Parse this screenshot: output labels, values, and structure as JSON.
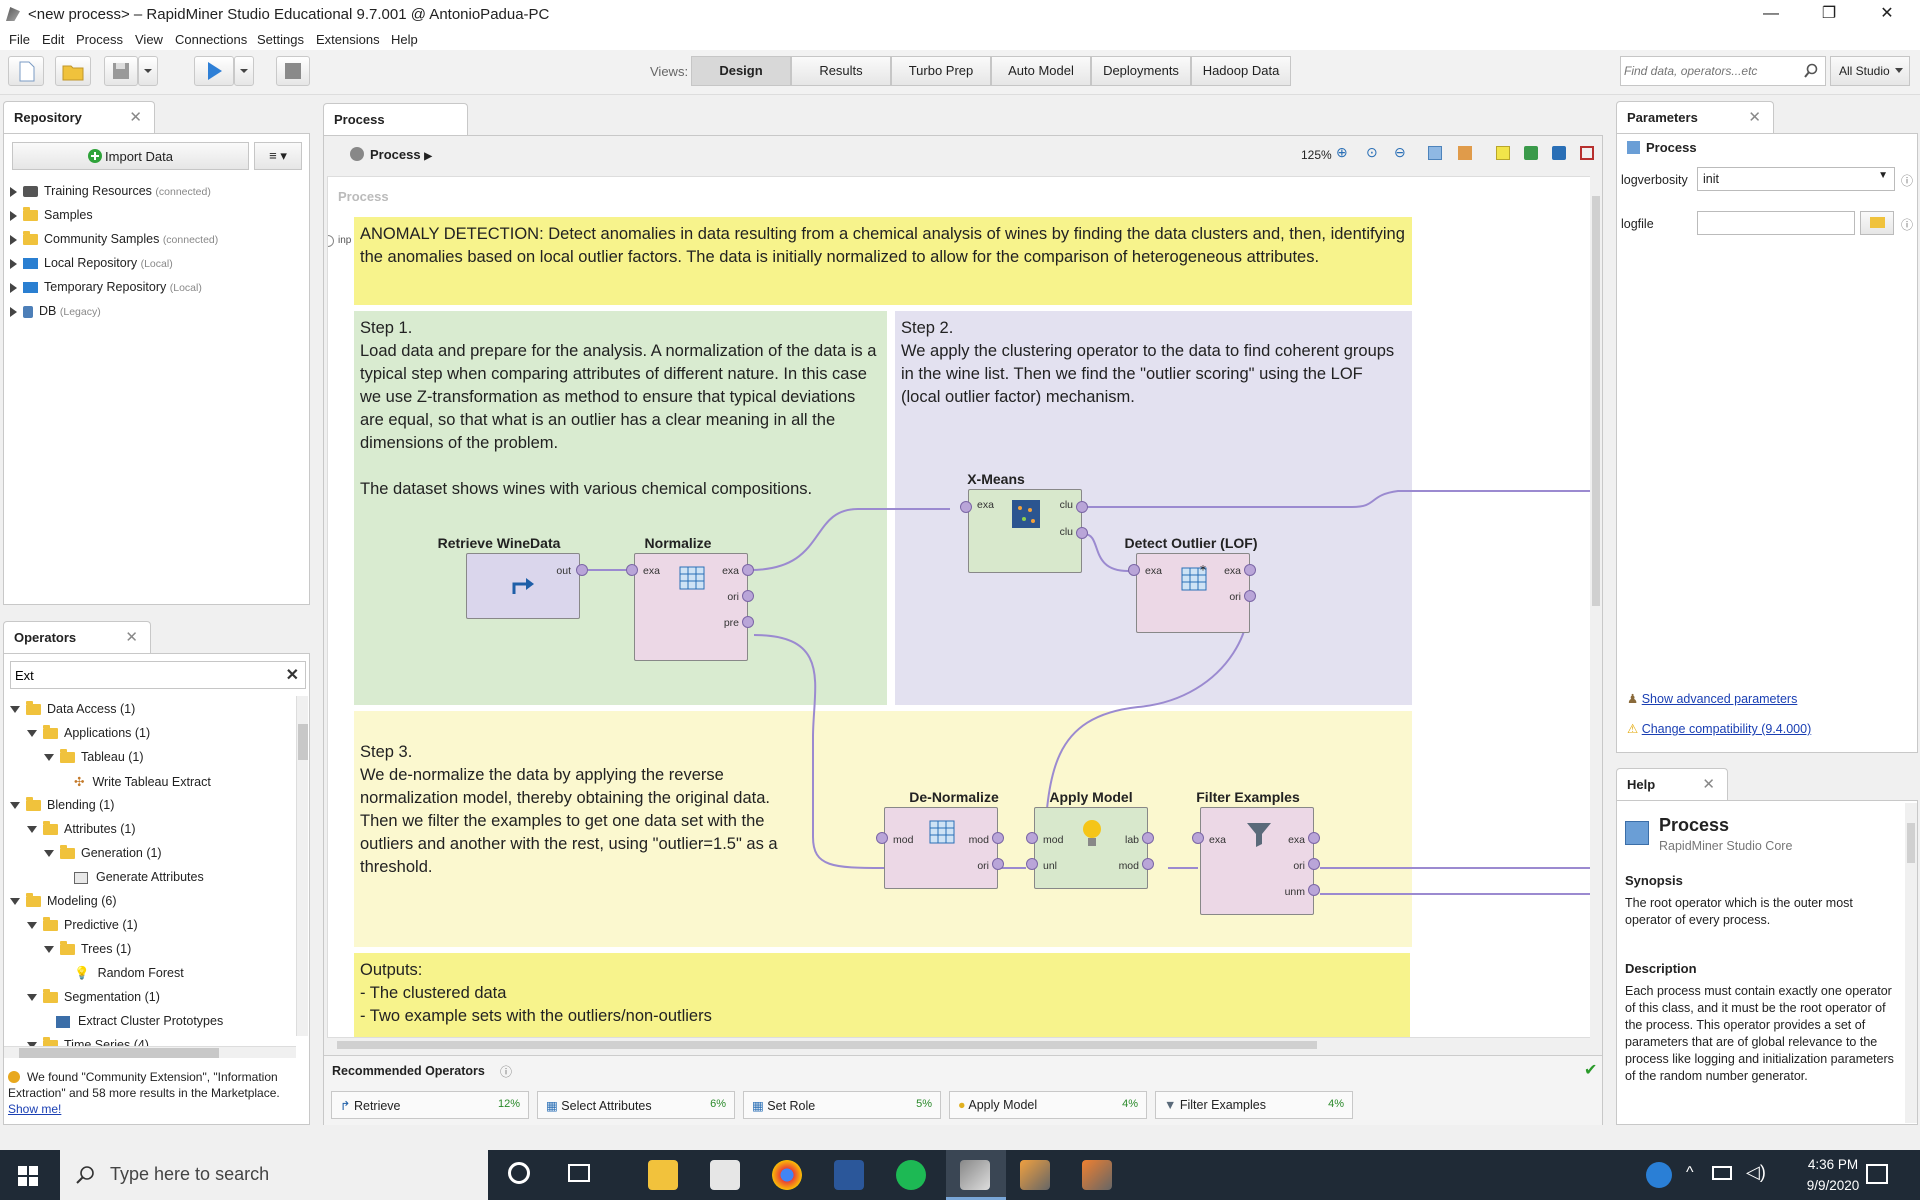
{
  "window": {
    "title": "<new process> – RapidMiner Studio Educational 9.7.001 @ AntonioPadua-PC",
    "minimize": "—",
    "restore": "❐",
    "close": "✕"
  },
  "menu": [
    "File",
    "Edit",
    "Process",
    "View",
    "Connections",
    "Settings",
    "Extensions",
    "Help"
  ],
  "views": {
    "label": "Views:",
    "items": [
      "Design",
      "Results",
      "Turbo Prep",
      "Auto Model",
      "Deployments",
      "Hadoop Data"
    ],
    "active": "Design"
  },
  "search": {
    "placeholder": "Find data, operators...etc",
    "scope": "All Studio"
  },
  "repository": {
    "tab": "Repository",
    "import_button": "Import Data",
    "items": [
      {
        "label": "Training Resources",
        "suffix": "(connected)"
      },
      {
        "label": "Samples",
        "suffix": ""
      },
      {
        "label": "Community Samples",
        "suffix": "(connected)"
      },
      {
        "label": "Local Repository",
        "suffix": "(Local)"
      },
      {
        "label": "Temporary Repository",
        "suffix": "(Local)"
      },
      {
        "label": "DB",
        "suffix": "(Legacy)"
      }
    ]
  },
  "operators": {
    "tab": "Operators",
    "filter_value": "Ext",
    "tree": [
      {
        "label": "Data Access (1)",
        "depth": 0
      },
      {
        "label": "Applications (1)",
        "depth": 1
      },
      {
        "label": "Tableau (1)",
        "depth": 2
      },
      {
        "label": "Write Tableau Extract",
        "depth": 3
      },
      {
        "label": "Blending (1)",
        "depth": 0
      },
      {
        "label": "Attributes (1)",
        "depth": 1
      },
      {
        "label": "Generation (1)",
        "depth": 2
      },
      {
        "label": "Generate Attributes",
        "depth": 3
      },
      {
        "label": "Modeling (6)",
        "depth": 0
      },
      {
        "label": "Predictive (1)",
        "depth": 1
      },
      {
        "label": "Trees (1)",
        "depth": 2
      },
      {
        "label": "Random Forest",
        "depth": 3
      },
      {
        "label": "Segmentation (1)",
        "depth": 1
      },
      {
        "label": "Extract Cluster Prototypes",
        "depth": 2
      },
      {
        "label": "Time Series (4)",
        "depth": 1
      }
    ],
    "marketplace_msg": "We found \"Community Extension\", \"Information Extraction\" and 58 more results in the Marketplace.",
    "marketplace_link": "Show me!"
  },
  "process": {
    "tab": "Process",
    "breadcrumb": "Process",
    "zoom": "125%",
    "canvas_label": "Process",
    "input_port": "inp",
    "notes": {
      "header": "ANOMALY DETECTION: Detect anomalies in data resulting from a chemical analysis of wines by finding the data clusters and, then, identifying the anomalies based on local outlier factors. The data is initially normalized to allow for the comparison of heterogeneous attributes.",
      "step1": "Step 1.\nLoad data and prepare for the analysis. A normalization of the data is a typical step when comparing attributes of different nature. In this case we use Z-transformation as method to ensure that typical deviations are equal, so that what is an outlier has a clear meaning in all the dimensions of the problem.\n\nThe dataset shows wines with various chemical compositions.",
      "step2": "Step 2.\nWe apply the clustering operator to the data to find coherent groups in the wine list. Then we find the \"outlier scoring\" using the LOF (local outlier factor) mechanism.",
      "step3": "Step 3.\nWe de-normalize the data by applying the reverse normalization model, thereby obtaining the original data. Then we filter the examples to get one data set with the outliers and another with the rest, using \"outlier=1.5\" as a threshold.",
      "outputs": "Outputs:\n- The clustered data\n- Two example sets with the outliers/non-outliers"
    },
    "operators": {
      "retrieve": {
        "title": "Retrieve WineData",
        "ports_out": [
          "out"
        ]
      },
      "normalize": {
        "title": "Normalize",
        "ports_in": [
          "exa"
        ],
        "ports_out": [
          "exa",
          "ori",
          "pre"
        ]
      },
      "xmeans": {
        "title": "X-Means",
        "ports_in": [
          "exa"
        ],
        "ports_out": [
          "clu",
          "clu"
        ]
      },
      "lof": {
        "title": "Detect Outlier (LOF)",
        "ports_in": [
          "exa"
        ],
        "ports_out": [
          "exa",
          "ori"
        ]
      },
      "denorm": {
        "title": "De-Normalize",
        "ports_in": [
          "mod"
        ],
        "ports_out": [
          "mod",
          "ori"
        ]
      },
      "apply": {
        "title": "Apply Model",
        "ports_in": [
          "mod",
          "unl"
        ],
        "ports_out": [
          "lab",
          "mod"
        ]
      },
      "filter": {
        "title": "Filter Examples",
        "ports_in": [
          "exa"
        ],
        "ports_out": [
          "exa",
          "ori",
          "unm"
        ]
      }
    }
  },
  "recommended": {
    "label": "Recommended Operators",
    "items": [
      {
        "label": "Retrieve",
        "pct": "12%"
      },
      {
        "label": "Select Attributes",
        "pct": "6%"
      },
      {
        "label": "Set Role",
        "pct": "5%"
      },
      {
        "label": "Apply Model",
        "pct": "4%"
      },
      {
        "label": "Filter Examples",
        "pct": "4%"
      }
    ]
  },
  "parameters": {
    "tab": "Parameters",
    "operator": "Process",
    "logverbosity_label": "logverbosity",
    "logverbosity_value": "init",
    "logfile_label": "logfile",
    "logfile_value": "",
    "advanced_link": "Show advanced parameters",
    "compat_link": "Change compatibility (9.4.000)"
  },
  "help": {
    "tab": "Help",
    "title": "Process",
    "subtitle": "RapidMiner Studio Core",
    "synopsis_h": "Synopsis",
    "synopsis": "The root operator which is the outer most operator of every process.",
    "description_h": "Description",
    "description": "Each process must contain exactly one operator of this class, and it must be the root operator of the process. This operator provides a set of parameters that are of global relevance to the process like logging and initialization parameters of the random number generator."
  },
  "taskbar": {
    "search_placeholder": "Type here to search",
    "time": "4:36 PM",
    "date": "9/9/2020"
  }
}
